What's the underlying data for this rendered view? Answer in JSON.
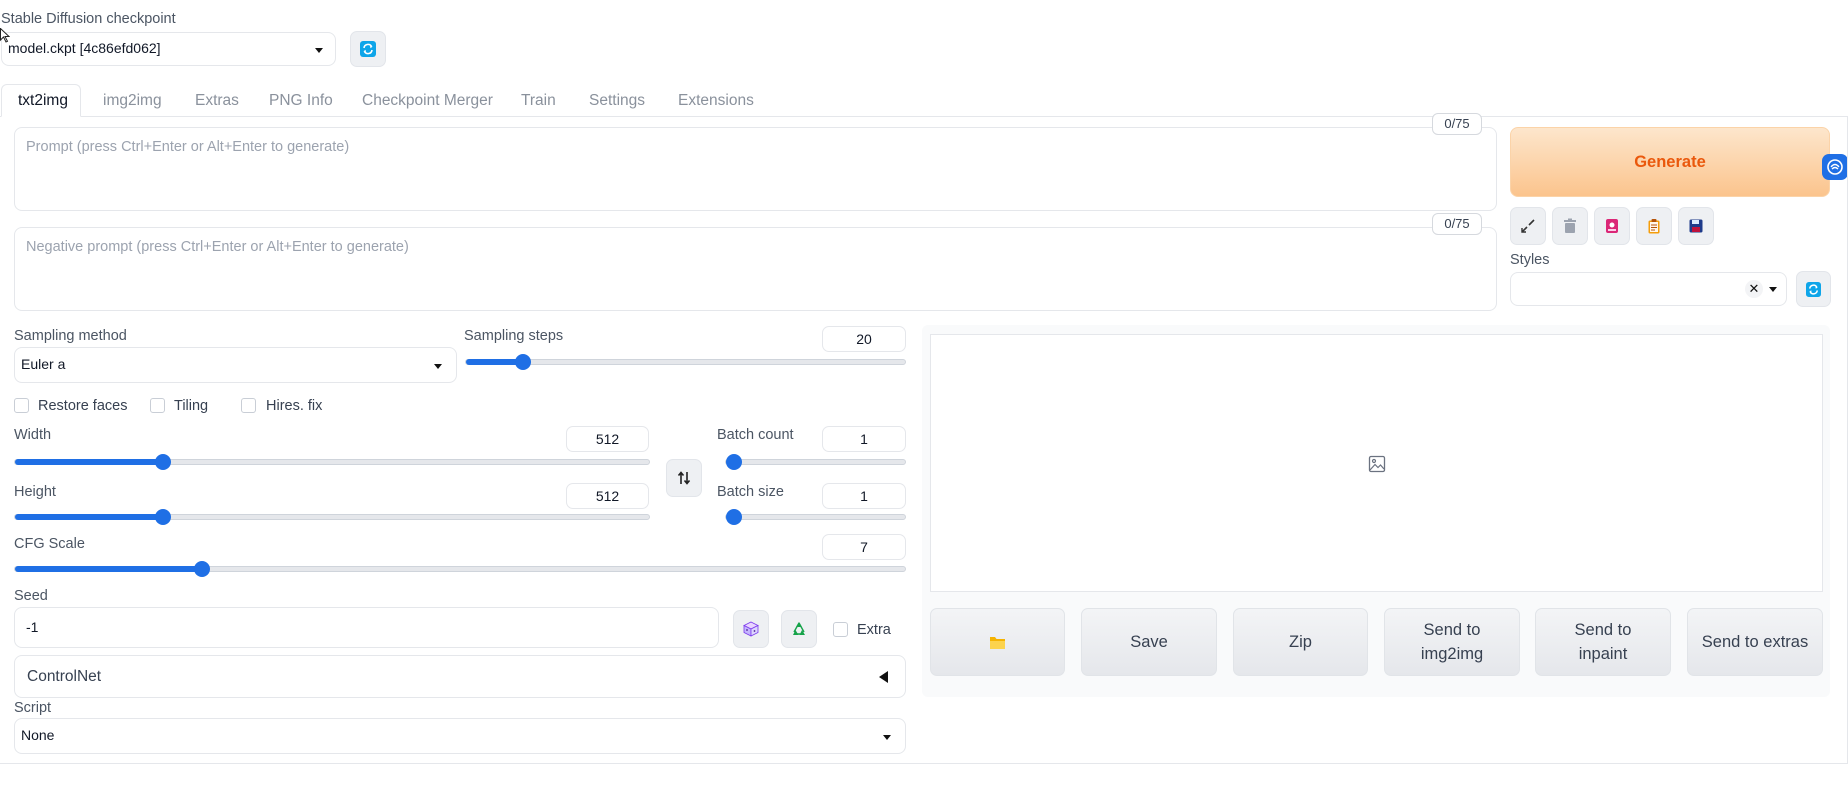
{
  "checkpoint": {
    "label": "Stable Diffusion checkpoint",
    "value": "model.ckpt [4c86efd062]"
  },
  "tabs": [
    "txt2img",
    "img2img",
    "Extras",
    "PNG Info",
    "Checkpoint Merger",
    "Train",
    "Settings",
    "Extensions"
  ],
  "active_tab": "txt2img",
  "prompt": {
    "placeholder": "Prompt (press Ctrl+Enter or Alt+Enter to generate)",
    "counter": "0/75"
  },
  "negative_prompt": {
    "placeholder": "Negative prompt (press Ctrl+Enter or Alt+Enter to generate)",
    "counter": "0/75"
  },
  "generate_label": "Generate",
  "styles": {
    "label": "Styles",
    "value": ""
  },
  "sampling_method": {
    "label": "Sampling method",
    "value": "Euler a"
  },
  "sampling_steps": {
    "label": "Sampling steps",
    "value": "20",
    "fraction": 0.13
  },
  "checkboxes": {
    "restore_faces": "Restore faces",
    "tiling": "Tiling",
    "hires_fix": "Hires. fix"
  },
  "width": {
    "label": "Width",
    "value": "512",
    "fraction": 0.233
  },
  "height": {
    "label": "Height",
    "value": "512",
    "fraction": 0.233
  },
  "batch_count": {
    "label": "Batch count",
    "value": "1",
    "fraction": 0.0
  },
  "batch_size": {
    "label": "Batch size",
    "value": "1",
    "fraction": 0.0
  },
  "cfg_scale": {
    "label": "CFG Scale",
    "value": "7",
    "fraction": 0.21
  },
  "seed": {
    "label": "Seed",
    "value": "-1",
    "extra_label": "Extra"
  },
  "controlnet_label": "ControlNet",
  "script": {
    "label": "Script",
    "value": "None"
  },
  "action_buttons": {
    "folder": "",
    "save": "Save",
    "zip": "Zip",
    "send_img2img": "Send to img2img",
    "send_inpaint": "Send to inpaint",
    "send_extras": "Send to extras"
  },
  "colors": {
    "accent": "#1f6fe5",
    "generate_text": "#ea580c",
    "generate_bg": "#fdd9b4",
    "refresh_icon": "#0ea5e9"
  },
  "icons": [
    "refresh-icon",
    "pencil-check-icon",
    "trash-icon",
    "photo-card-icon",
    "clipboard-icon",
    "save-floppy-icon",
    "swap-icon",
    "dice-icon",
    "recycle-icon",
    "image-placeholder-icon",
    "folder-icon"
  ]
}
